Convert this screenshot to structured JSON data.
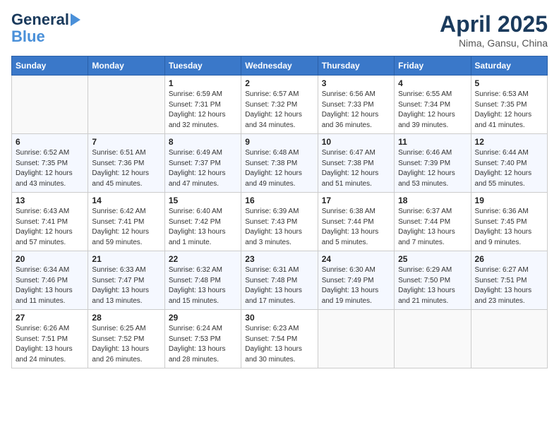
{
  "header": {
    "logo_line1": "General",
    "logo_line2": "Blue",
    "month": "April 2025",
    "location": "Nima, Gansu, China"
  },
  "days_of_week": [
    "Sunday",
    "Monday",
    "Tuesday",
    "Wednesday",
    "Thursday",
    "Friday",
    "Saturday"
  ],
  "weeks": [
    [
      {
        "day": "",
        "info": ""
      },
      {
        "day": "",
        "info": ""
      },
      {
        "day": "1",
        "info": "Sunrise: 6:59 AM\nSunset: 7:31 PM\nDaylight: 12 hours\nand 32 minutes."
      },
      {
        "day": "2",
        "info": "Sunrise: 6:57 AM\nSunset: 7:32 PM\nDaylight: 12 hours\nand 34 minutes."
      },
      {
        "day": "3",
        "info": "Sunrise: 6:56 AM\nSunset: 7:33 PM\nDaylight: 12 hours\nand 36 minutes."
      },
      {
        "day": "4",
        "info": "Sunrise: 6:55 AM\nSunset: 7:34 PM\nDaylight: 12 hours\nand 39 minutes."
      },
      {
        "day": "5",
        "info": "Sunrise: 6:53 AM\nSunset: 7:35 PM\nDaylight: 12 hours\nand 41 minutes."
      }
    ],
    [
      {
        "day": "6",
        "info": "Sunrise: 6:52 AM\nSunset: 7:35 PM\nDaylight: 12 hours\nand 43 minutes."
      },
      {
        "day": "7",
        "info": "Sunrise: 6:51 AM\nSunset: 7:36 PM\nDaylight: 12 hours\nand 45 minutes."
      },
      {
        "day": "8",
        "info": "Sunrise: 6:49 AM\nSunset: 7:37 PM\nDaylight: 12 hours\nand 47 minutes."
      },
      {
        "day": "9",
        "info": "Sunrise: 6:48 AM\nSunset: 7:38 PM\nDaylight: 12 hours\nand 49 minutes."
      },
      {
        "day": "10",
        "info": "Sunrise: 6:47 AM\nSunset: 7:38 PM\nDaylight: 12 hours\nand 51 minutes."
      },
      {
        "day": "11",
        "info": "Sunrise: 6:46 AM\nSunset: 7:39 PM\nDaylight: 12 hours\nand 53 minutes."
      },
      {
        "day": "12",
        "info": "Sunrise: 6:44 AM\nSunset: 7:40 PM\nDaylight: 12 hours\nand 55 minutes."
      }
    ],
    [
      {
        "day": "13",
        "info": "Sunrise: 6:43 AM\nSunset: 7:41 PM\nDaylight: 12 hours\nand 57 minutes."
      },
      {
        "day": "14",
        "info": "Sunrise: 6:42 AM\nSunset: 7:41 PM\nDaylight: 12 hours\nand 59 minutes."
      },
      {
        "day": "15",
        "info": "Sunrise: 6:40 AM\nSunset: 7:42 PM\nDaylight: 13 hours\nand 1 minute."
      },
      {
        "day": "16",
        "info": "Sunrise: 6:39 AM\nSunset: 7:43 PM\nDaylight: 13 hours\nand 3 minutes."
      },
      {
        "day": "17",
        "info": "Sunrise: 6:38 AM\nSunset: 7:44 PM\nDaylight: 13 hours\nand 5 minutes."
      },
      {
        "day": "18",
        "info": "Sunrise: 6:37 AM\nSunset: 7:44 PM\nDaylight: 13 hours\nand 7 minutes."
      },
      {
        "day": "19",
        "info": "Sunrise: 6:36 AM\nSunset: 7:45 PM\nDaylight: 13 hours\nand 9 minutes."
      }
    ],
    [
      {
        "day": "20",
        "info": "Sunrise: 6:34 AM\nSunset: 7:46 PM\nDaylight: 13 hours\nand 11 minutes."
      },
      {
        "day": "21",
        "info": "Sunrise: 6:33 AM\nSunset: 7:47 PM\nDaylight: 13 hours\nand 13 minutes."
      },
      {
        "day": "22",
        "info": "Sunrise: 6:32 AM\nSunset: 7:48 PM\nDaylight: 13 hours\nand 15 minutes."
      },
      {
        "day": "23",
        "info": "Sunrise: 6:31 AM\nSunset: 7:48 PM\nDaylight: 13 hours\nand 17 minutes."
      },
      {
        "day": "24",
        "info": "Sunrise: 6:30 AM\nSunset: 7:49 PM\nDaylight: 13 hours\nand 19 minutes."
      },
      {
        "day": "25",
        "info": "Sunrise: 6:29 AM\nSunset: 7:50 PM\nDaylight: 13 hours\nand 21 minutes."
      },
      {
        "day": "26",
        "info": "Sunrise: 6:27 AM\nSunset: 7:51 PM\nDaylight: 13 hours\nand 23 minutes."
      }
    ],
    [
      {
        "day": "27",
        "info": "Sunrise: 6:26 AM\nSunset: 7:51 PM\nDaylight: 13 hours\nand 24 minutes."
      },
      {
        "day": "28",
        "info": "Sunrise: 6:25 AM\nSunset: 7:52 PM\nDaylight: 13 hours\nand 26 minutes."
      },
      {
        "day": "29",
        "info": "Sunrise: 6:24 AM\nSunset: 7:53 PM\nDaylight: 13 hours\nand 28 minutes."
      },
      {
        "day": "30",
        "info": "Sunrise: 6:23 AM\nSunset: 7:54 PM\nDaylight: 13 hours\nand 30 minutes."
      },
      {
        "day": "",
        "info": ""
      },
      {
        "day": "",
        "info": ""
      },
      {
        "day": "",
        "info": ""
      }
    ]
  ]
}
